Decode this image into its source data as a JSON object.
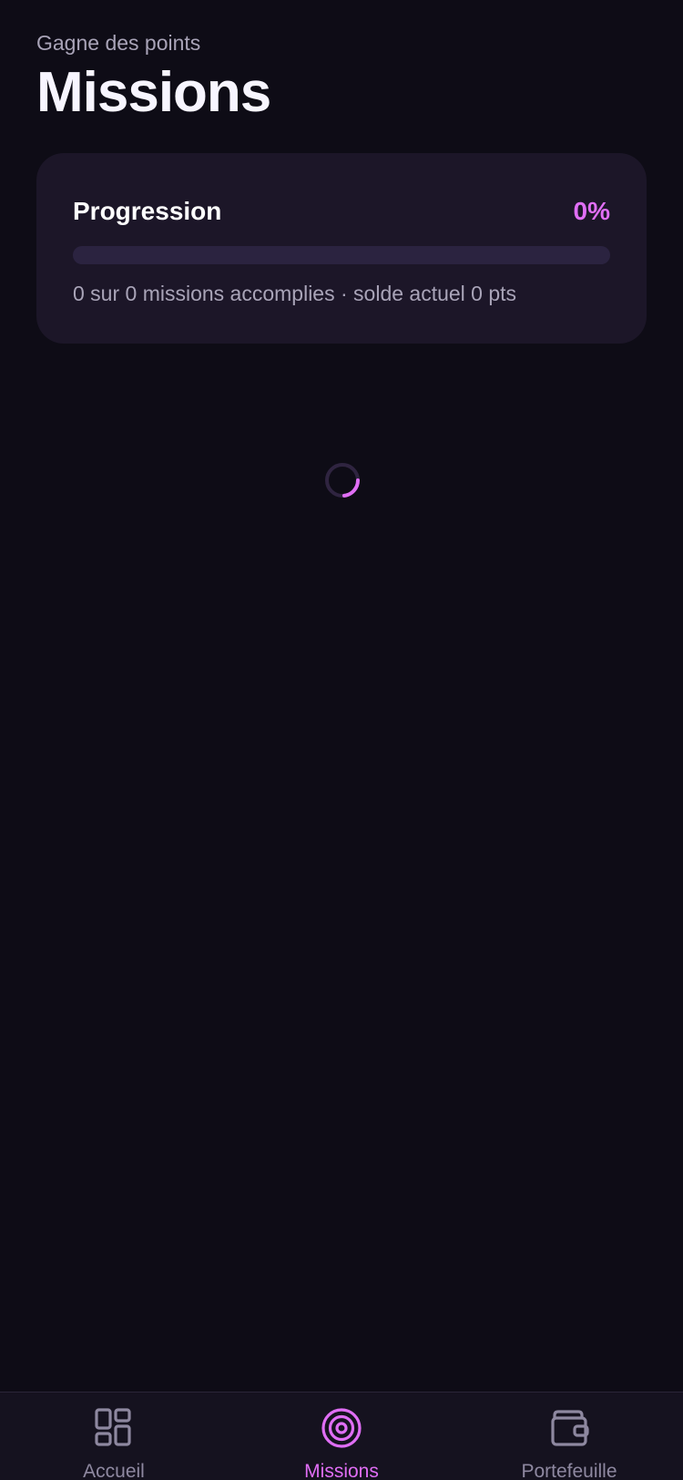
{
  "header": {
    "subtitle": "Gagne des points",
    "title": "Missions"
  },
  "progress": {
    "title": "Progression",
    "percent_label": "0%",
    "percent_value": 0,
    "caption": "0 sur 0 missions accomplies · solde actuel 0 pts"
  },
  "loading": {
    "indicator": "loading-spinner"
  },
  "bottom_nav": {
    "items": [
      {
        "label": "Accueil",
        "icon": "grid-icon",
        "active": false
      },
      {
        "label": "Missions",
        "icon": "target-icon",
        "active": true
      },
      {
        "label": "Portefeuille",
        "icon": "wallet-icon",
        "active": false
      }
    ]
  },
  "colors": {
    "background": "#0e0c16",
    "card": "#1c1628",
    "accent": "#e06ef5",
    "muted_text": "#a9a4b8",
    "nav_inactive": "#8e88a0"
  }
}
